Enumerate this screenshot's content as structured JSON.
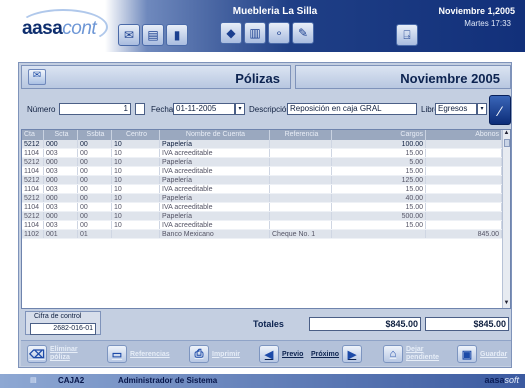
{
  "header": {
    "logo_a": "aasa",
    "logo_b": "cont",
    "company": "Muebleria La Silla",
    "date": "Noviembre 1,2005",
    "time": "Martes 17:33"
  },
  "toolbar": {
    "icons": [
      "document-icon",
      "calendar-icon",
      "chart-icon",
      "book-icon",
      "books-icon",
      "group-icon",
      "settings-icon",
      "exit-icon"
    ]
  },
  "titlebar": {
    "title": "Pólizas",
    "period": "Noviembre 2005"
  },
  "form": {
    "numero_label": "Número",
    "numero_value": "1",
    "fecha_label": "Fecha",
    "fecha_value": "01-11-2005",
    "descripcion_label": "Descripción",
    "descripcion_value": "Reposición en caja GRAL",
    "libro_label": "Libro",
    "libro_value": "Egresos"
  },
  "table": {
    "headers": [
      "Cta",
      "Scta",
      "Ssbta",
      "Centro",
      "Nombre de Cuenta",
      "Referencia",
      "Cargos",
      "Abonos"
    ],
    "rows": [
      [
        "5212",
        "000",
        "00",
        "10",
        "Papelería",
        "",
        "100.00",
        ""
      ],
      [
        "1104",
        "003",
        "00",
        "10",
        "IVA acreeditable",
        "",
        "15.00",
        ""
      ],
      [
        "5212",
        "000",
        "00",
        "10",
        "Papelería",
        "",
        "5.00",
        ""
      ],
      [
        "1104",
        "003",
        "00",
        "10",
        "IVA acreeditable",
        "",
        "15.00",
        ""
      ],
      [
        "5212",
        "000",
        "00",
        "10",
        "Papelería",
        "",
        "125.00",
        ""
      ],
      [
        "1104",
        "003",
        "00",
        "10",
        "IVA acreeditable",
        "",
        "15.00",
        ""
      ],
      [
        "5212",
        "000",
        "00",
        "10",
        "Papelería",
        "",
        "40.00",
        ""
      ],
      [
        "1104",
        "003",
        "00",
        "10",
        "IVA acreeditable",
        "",
        "15.00",
        ""
      ],
      [
        "5212",
        "000",
        "00",
        "10",
        "Papelería",
        "",
        "500.00",
        ""
      ],
      [
        "1104",
        "003",
        "00",
        "10",
        "IVA acreeditable",
        "",
        "15.00",
        ""
      ],
      [
        "1102",
        "001",
        "01",
        "",
        "Banco Mexicano",
        "Cheque No. 1",
        "",
        "845.00"
      ]
    ]
  },
  "footer": {
    "cifra_label": "Cifra de control",
    "cifra_value": "2682-016-01",
    "totales_label": "Totales",
    "total_cargos": "$845.00",
    "total_abonos": "$845.00"
  },
  "buttons": {
    "eliminar": "Eliminar póliza",
    "referencias": "Referencias",
    "imprimir": "Imprimir",
    "previo": "Previo",
    "proximo": "Próximo",
    "dejar": "Dejar pendiente",
    "guardar": "Guardar"
  },
  "status": {
    "station": "CAJA2",
    "user": "Administrador de Sistema",
    "brand_a": "aasa",
    "brand_b": "soft"
  }
}
